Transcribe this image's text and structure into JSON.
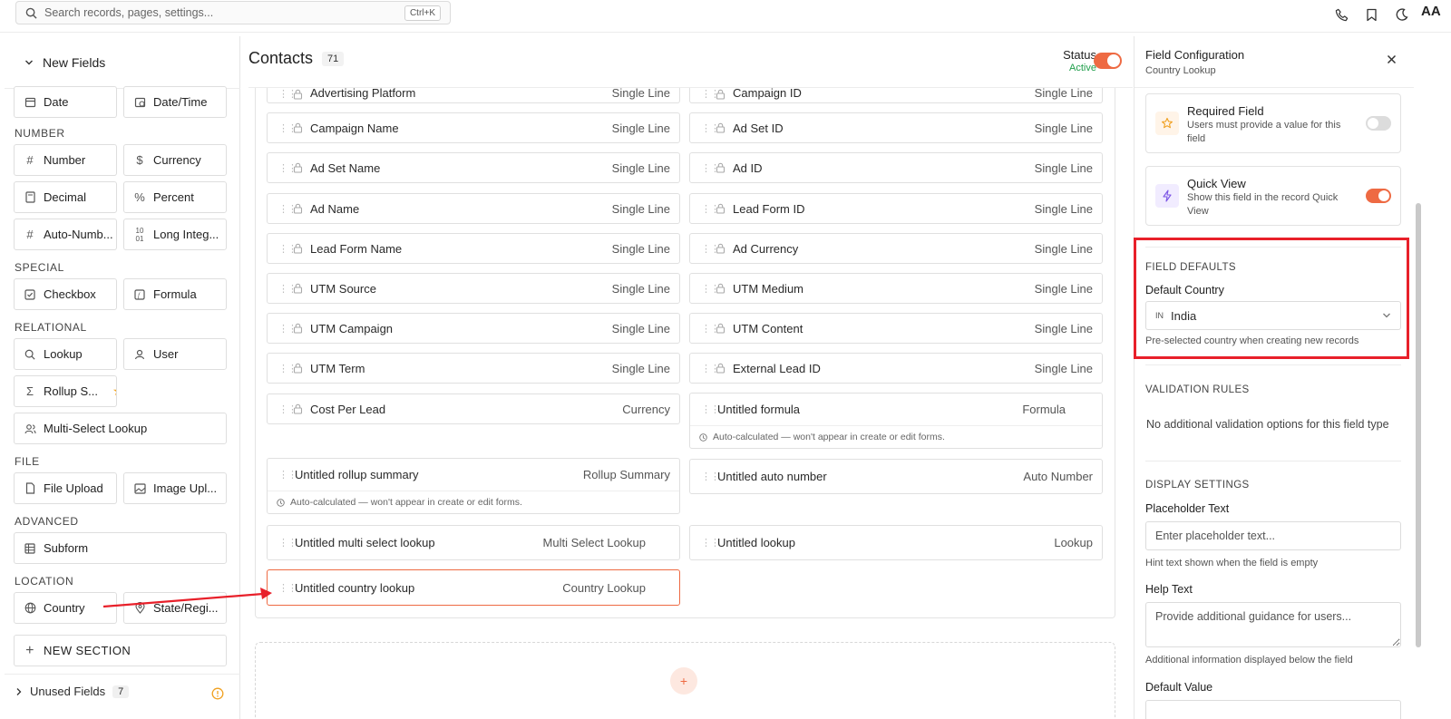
{
  "topbar": {
    "search_placeholder": "Search records, pages, settings...",
    "shortcut": "Ctrl+K",
    "avatar": "AA"
  },
  "left": {
    "header": "New Fields",
    "date_tiles": [
      "Date",
      "Date/Time"
    ],
    "number_section": "NUMBER",
    "number_tiles": [
      "Number",
      "Currency",
      "Decimal",
      "Percent",
      "Auto-Numb...",
      "Long Integ..."
    ],
    "special_section": "SPECIAL",
    "special_tiles": [
      "Checkbox",
      "Formula"
    ],
    "relational_section": "RELATIONAL",
    "relational_tiles": [
      "Lookup",
      "User",
      "Rollup S...",
      "Multi-Select Lookup"
    ],
    "file_section": "FILE",
    "file_tiles": [
      "File Upload",
      "Image Upl..."
    ],
    "advanced_section": "ADVANCED",
    "advanced_tiles": [
      "Subform"
    ],
    "location_section": "LOCATION",
    "location_tiles": [
      "Country",
      "State/Regi..."
    ],
    "new_section": "NEW SECTION",
    "unused_label": "Unused Fields",
    "unused_count": "7"
  },
  "center": {
    "title": "Contacts",
    "count": "71",
    "status_label": "Status",
    "status_value": "Active",
    "left_col": [
      {
        "name": "Advertising Platform",
        "type": "Single Line"
      },
      {
        "name": "Campaign Name",
        "type": "Single Line"
      },
      {
        "name": "Ad Set Name",
        "type": "Single Line"
      },
      {
        "name": "Ad Name",
        "type": "Single Line"
      },
      {
        "name": "Lead Form Name",
        "type": "Single Line"
      },
      {
        "name": "UTM Source",
        "type": "Single Line"
      },
      {
        "name": "UTM Campaign",
        "type": "Single Line"
      },
      {
        "name": "UTM Term",
        "type": "Single Line"
      },
      {
        "name": "Cost Per Lead",
        "type": "Currency"
      }
    ],
    "right_col": [
      {
        "name": "Campaign ID",
        "type": "Single Line"
      },
      {
        "name": "Ad Set ID",
        "type": "Single Line"
      },
      {
        "name": "Ad ID",
        "type": "Single Line"
      },
      {
        "name": "Lead Form ID",
        "type": "Single Line"
      },
      {
        "name": "Ad Currency",
        "type": "Single Line"
      },
      {
        "name": "UTM Medium",
        "type": "Single Line"
      },
      {
        "name": "UTM Content",
        "type": "Single Line"
      },
      {
        "name": "External Lead ID",
        "type": "Single Line"
      }
    ],
    "formula": {
      "name": "Untitled formula",
      "type": "Formula"
    },
    "auto_note": "Auto-calculated — won't appear in create or edit forms.",
    "rollup": {
      "name": "Untitled rollup summary",
      "type": "Rollup Summary"
    },
    "autonum": {
      "name": "Untitled auto number",
      "type": "Auto Number"
    },
    "multi": {
      "name": "Untitled multi select lookup",
      "type": "Multi Select Lookup"
    },
    "lookup": {
      "name": "Untitled lookup",
      "type": "Lookup"
    },
    "country": {
      "name": "Untitled country lookup",
      "type": "Country Lookup"
    }
  },
  "right": {
    "title": "Field Configuration",
    "subtitle": "Country Lookup",
    "required_title": "Required Field",
    "required_desc": "Users must provide a value for this field",
    "quick_title": "Quick View",
    "quick_desc": "Show this field in the record Quick View",
    "defaults_section": "FIELD DEFAULTS",
    "default_country_label": "Default Country",
    "default_country_code": "IN",
    "default_country_value": "India",
    "default_country_hint": "Pre-selected country when creating new records",
    "validation_section": "VALIDATION RULES",
    "validation_note": "No additional validation options for this field type",
    "display_section": "DISPLAY SETTINGS",
    "placeholder_label": "Placeholder Text",
    "placeholder_input": "Enter placeholder text...",
    "placeholder_hint": "Hint text shown when the field is empty",
    "help_label": "Help Text",
    "help_input": "Provide additional guidance for users...",
    "help_hint": "Additional information displayed below the field",
    "default_value_label": "Default Value"
  },
  "colors": {
    "accent": "#ee6a43",
    "active": "#1e9e4a",
    "highlight": "#e8202a"
  }
}
